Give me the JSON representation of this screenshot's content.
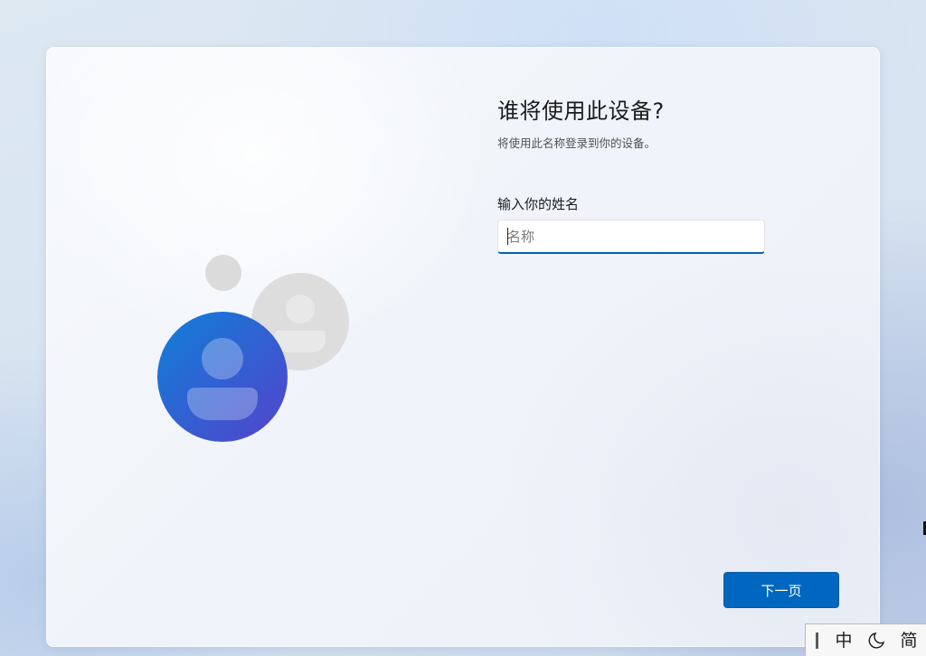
{
  "setup": {
    "title": "谁将使用此设备?",
    "subtitle": "将使用此名称登录到你的设备。",
    "name_field": {
      "label": "输入你的姓名",
      "placeholder": "名称",
      "value": ""
    },
    "next_button_label": "下一页"
  },
  "illustration": {
    "primary_colors": [
      "#1478d4",
      "#4a4ad0"
    ],
    "secondary_color": "#dedddd"
  },
  "ime_toolbar": {
    "mode_label": "中",
    "moon_icon": "half-moon-icon",
    "charset_label": "简"
  },
  "colors": {
    "accent": "#0067c0",
    "input_underline": "#0063b1"
  }
}
